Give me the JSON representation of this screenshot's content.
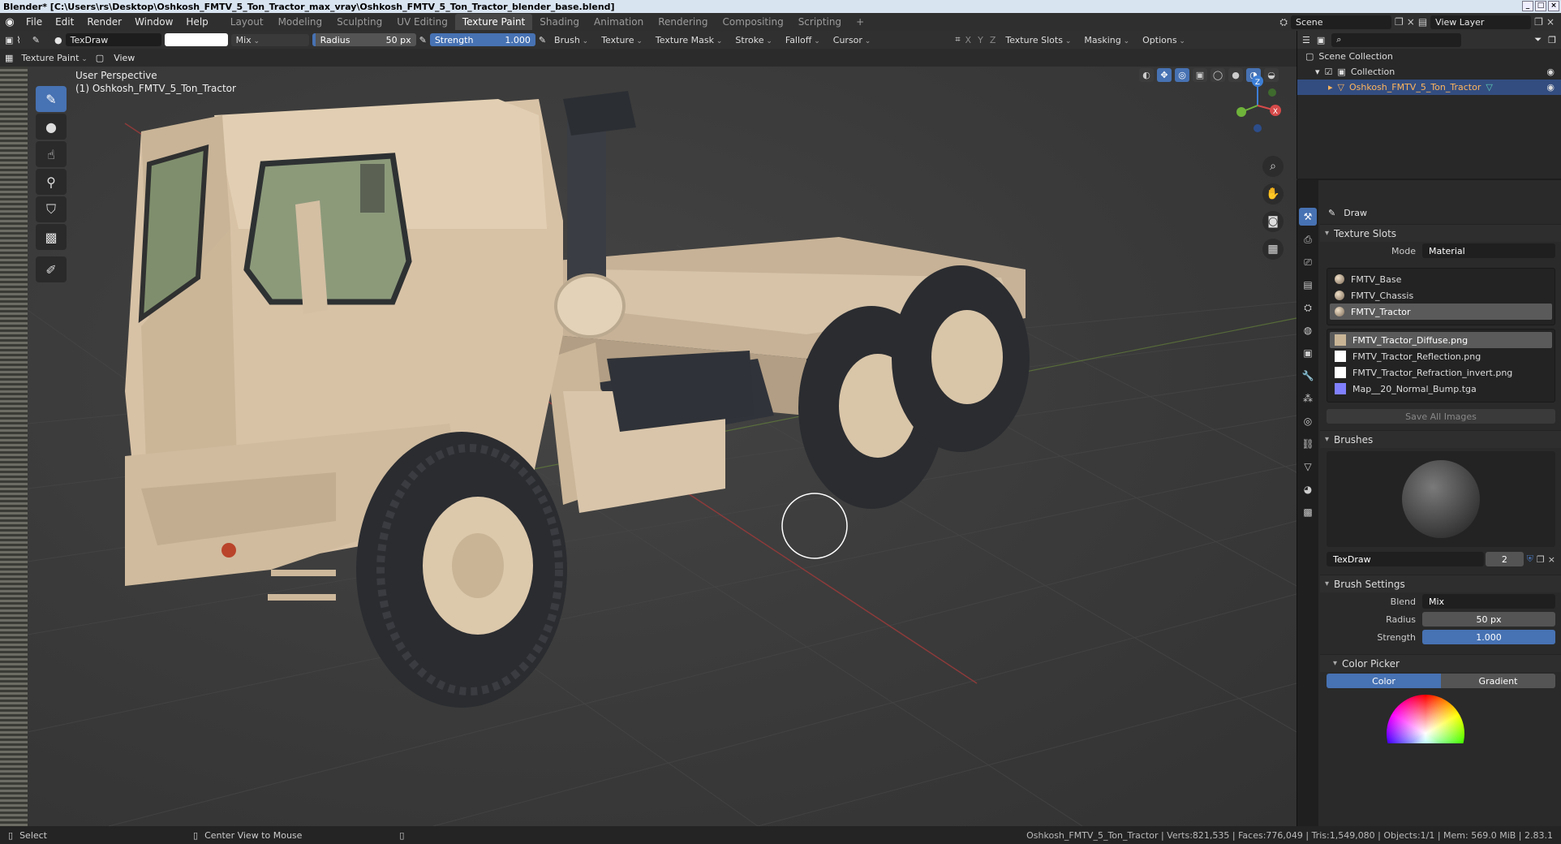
{
  "title": "Blender* [C:\\Users\\rs\\Desktop\\Oshkosh_FMTV_5_Ton_Tractor_max_vray\\Oshkosh_FMTV_5_Ton_Tractor_blender_base.blend]",
  "menus": [
    "File",
    "Edit",
    "Render",
    "Window",
    "Help"
  ],
  "workspaces": [
    "Layout",
    "Modeling",
    "Sculpting",
    "UV Editing",
    "Texture Paint",
    "Shading",
    "Animation",
    "Rendering",
    "Compositing",
    "Scripting"
  ],
  "active_workspace": "Texture Paint",
  "scene": "Scene",
  "view_layer": "View Layer",
  "tool_header": {
    "brush_name": "TexDraw",
    "blend_mode": "Mix",
    "radius_label": "Radius",
    "radius_value": "50 px",
    "strength_label": "Strength",
    "strength_value": "1.000",
    "menus": [
      "Brush",
      "Texture",
      "Texture Mask",
      "Stroke",
      "Falloff",
      "Cursor"
    ],
    "axes": [
      "X",
      "Y",
      "Z"
    ],
    "right_menus": [
      "Texture Slots",
      "Masking",
      "Options"
    ],
    "paint_color": "#ffffff"
  },
  "sub_header": {
    "mode": "Texture Paint",
    "view": "View"
  },
  "viewport": {
    "perspective": "User Perspective",
    "object_label": "(1) Oshkosh_FMTV_5_Ton_Tractor",
    "gizmo_labels": [
      "X",
      "Y",
      "Z"
    ]
  },
  "outliner": {
    "root": "Scene Collection",
    "collection": "Collection",
    "object": "Oshkosh_FMTV_5_Ton_Tractor"
  },
  "properties": {
    "tool_name": "Draw",
    "texture_slots_title": "Texture Slots",
    "mode_label": "Mode",
    "mode_value": "Material",
    "materials": [
      "FMTV_Base",
      "FMTV_Chassis",
      "FMTV_Tractor"
    ],
    "selected_material": "FMTV_Tractor",
    "images": [
      "FMTV_Tractor_Diffuse.png",
      "FMTV_Tractor_Reflection.png",
      "FMTV_Tractor_Refraction_invert.png",
      "Map__20_Normal_Bump.tga"
    ],
    "selected_image": "FMTV_Tractor_Diffuse.png",
    "save_all": "Save All Images",
    "brushes_title": "Brushes",
    "brush_name": "TexDraw",
    "brush_users": "2",
    "brush_settings_title": "Brush Settings",
    "blend_label": "Blend",
    "blend_value": "Mix",
    "radius_label": "Radius",
    "radius_value": "50 px",
    "strength_label": "Strength",
    "strength_value": "1.000",
    "color_picker_title": "Color Picker",
    "color_tab": "Color",
    "gradient_tab": "Gradient"
  },
  "status": {
    "left_action": "Select",
    "middle_action": "Center View to Mouse",
    "stats": "Oshkosh_FMTV_5_Ton_Tractor | Verts:821,535 | Faces:776,049 | Tris:1,549,080 | Objects:1/1 | Mem: 569.0 MiB | 2.83.1"
  },
  "colors": {
    "accent": "#4772b3",
    "truck_body": "#d8c2a6",
    "tire": "#2a2c30"
  }
}
